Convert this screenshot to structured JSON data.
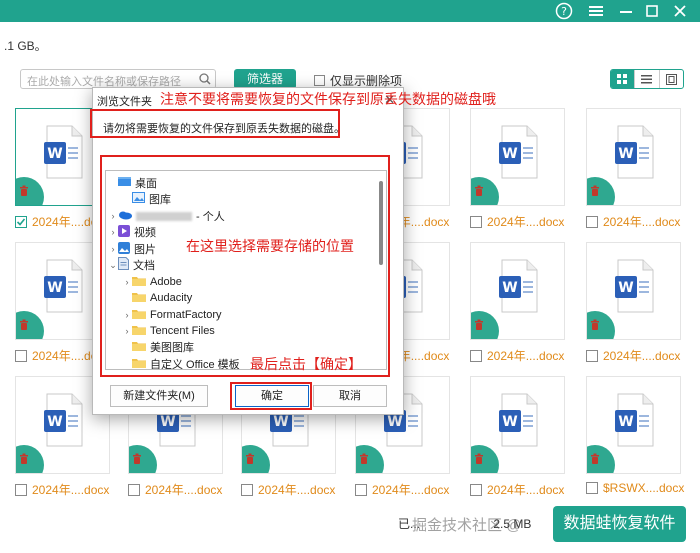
{
  "header": {
    "help_icon": "help-icon",
    "menu_icon": "menu-icon",
    "minimize_icon": "minimize-icon",
    "close_icon": "close-icon",
    "color": "#20a38e"
  },
  "size_text": ".1 GB。",
  "toolbar": {
    "search_placeholder": "在此处输入文件名称或保存路径",
    "filter_label": "筛选器",
    "deleted_only_label": "仅显示删除项"
  },
  "files": [
    {
      "name": "2024年....docx",
      "checked": true
    },
    {
      "name": "2024年....docx",
      "checked": false
    },
    {
      "name": "2024年....docx",
      "checked": false
    },
    {
      "name": "2024年....docx",
      "checked": false
    },
    {
      "name": "2024年....docx",
      "checked": false
    },
    {
      "name": "2024年....docx",
      "checked": false
    },
    {
      "name": "2024年....docx",
      "checked": false
    },
    {
      "name": "2024年....docx",
      "checked": false
    },
    {
      "name": "2024年....docx",
      "checked": false
    },
    {
      "name": "2024年....docx",
      "checked": false
    },
    {
      "name": "2024年....docx",
      "checked": false
    },
    {
      "name": "2024年....docx",
      "checked": false
    },
    {
      "name": "2024年....docx",
      "checked": false
    },
    {
      "name": "2024年....docx",
      "checked": false
    },
    {
      "name": "2024年....docx",
      "checked": false
    },
    {
      "name": "2024年....docx",
      "checked": false
    },
    {
      "name": "2024年....docx",
      "checked": false
    },
    {
      "name": "$RSWX....docx",
      "checked": false
    }
  ],
  "status": {
    "selected_text": "已...",
    "size_text": "2.5 MB",
    "recover_label": "数据蛙恢复软件",
    "watermark": "掘金技术社区 @"
  },
  "dialog": {
    "title": "浏览文件夹",
    "message": "请勿将需要恢复的文件保存到原丢失数据的磁盘。",
    "tree": [
      {
        "label": "桌面",
        "icon": "desktop-folder-icon",
        "expander": ""
      },
      {
        "label": "图库",
        "icon": "gallery-icon",
        "expander": ""
      },
      {
        "label": "- 个人",
        "icon": "onedrive-icon",
        "expander": ">"
      },
      {
        "label": "视频",
        "icon": "video-folder-icon",
        "expander": ">"
      },
      {
        "label": "图片",
        "icon": "pictures-folder-icon",
        "expander": ">"
      },
      {
        "label": "文档",
        "icon": "documents-folder-icon",
        "expander": "v"
      },
      {
        "label": "Adobe",
        "icon": "folder-icon",
        "expander": ">"
      },
      {
        "label": "Audacity",
        "icon": "folder-icon",
        "expander": ""
      },
      {
        "label": "FormatFactory",
        "icon": "folder-icon",
        "expander": ">"
      },
      {
        "label": "Tencent Files",
        "icon": "folder-icon",
        "expander": ">"
      },
      {
        "label": "美图图库",
        "icon": "folder-icon",
        "expander": ""
      },
      {
        "label": "自定义 Office 模板",
        "icon": "folder-icon",
        "expander": ""
      }
    ],
    "new_folder_label": "新建文件夹(M)",
    "ok_label": "确定",
    "cancel_label": "取消"
  },
  "annotations": {
    "warning": "注意不要将需要恢复的文件保存到原丢失数据的磁盘哦",
    "choose_location": "在这里选择需要存储的位置",
    "click_ok": "最后点击【确定】",
    "color": "#e0201c"
  }
}
